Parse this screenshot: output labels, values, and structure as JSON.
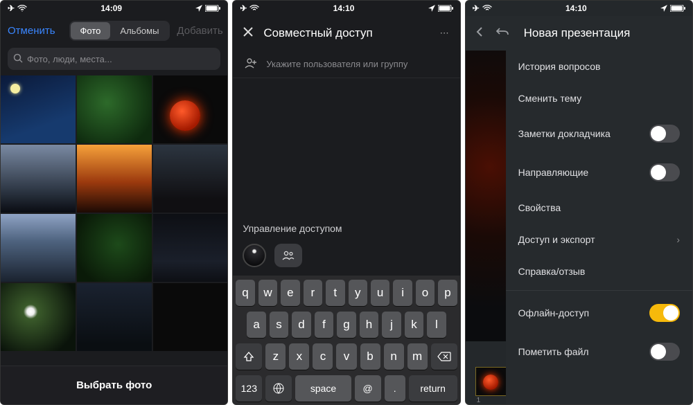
{
  "status": {
    "time1": "14:09",
    "time2": "14:10",
    "time3": "14:10"
  },
  "screen1": {
    "cancel": "Отменить",
    "seg_photos": "Фото",
    "seg_albums": "Альбомы",
    "add": "Добавить",
    "search_placeholder": "Фото, люди, места...",
    "select": "Выбрать фото"
  },
  "screen2": {
    "title": "Совместный доступ",
    "add_user_placeholder": "Укажите пользователя или группу",
    "access_label": "Управление доступом",
    "keyboard": {
      "row1": [
        "q",
        "w",
        "e",
        "r",
        "t",
        "y",
        "u",
        "i",
        "o",
        "p"
      ],
      "row2": [
        "a",
        "s",
        "d",
        "f",
        "g",
        "h",
        "j",
        "k",
        "l"
      ],
      "row3": [
        "z",
        "x",
        "c",
        "v",
        "b",
        "n",
        "m"
      ],
      "num": "123",
      "space": "space",
      "at": "@",
      "dot": ".",
      "return": "return"
    }
  },
  "screen3": {
    "title": "Новая презентация",
    "items": [
      "История вопросов",
      "Сменить тему",
      "Заметки докладчика",
      "Направляющие",
      "Свойства",
      "Доступ и экспорт",
      "Справка/отзыв",
      "Офлайн-доступ",
      "Пометить файл"
    ],
    "slide_num": "1"
  }
}
